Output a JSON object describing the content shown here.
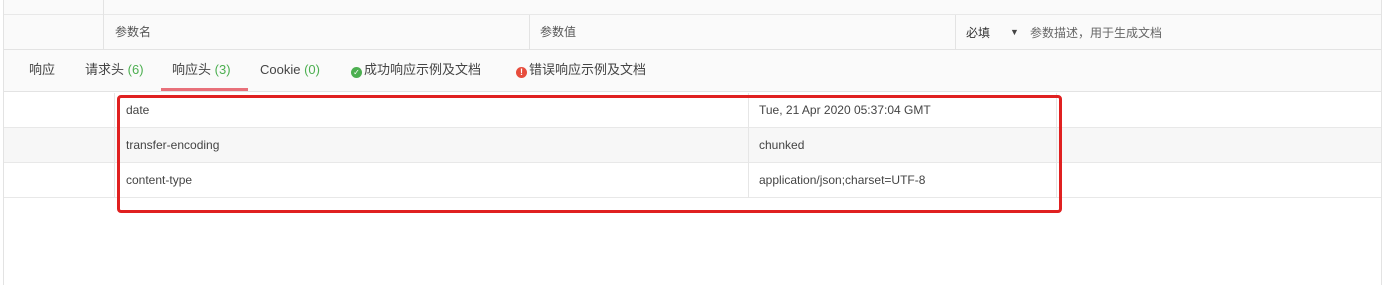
{
  "params_header": {
    "name_placeholder": "参数名",
    "value_placeholder": "参数值",
    "required_label": "必填",
    "description_placeholder": "参数描述，用于生成文档"
  },
  "tabs": [
    {
      "label": "响应",
      "count": ""
    },
    {
      "label": "请求头",
      "count": "(6)"
    },
    {
      "label": "响应头",
      "count": "(3)"
    },
    {
      "label": "Cookie",
      "count": "(0)"
    },
    {
      "label": "成功响应示例及文档",
      "count": ""
    },
    {
      "label": "错误响应示例及文档",
      "count": ""
    }
  ],
  "active_tab": "响应头",
  "icons": {
    "success": "check-circle-icon",
    "error": "exclamation-circle-icon",
    "dropdown": "caret-down-icon"
  },
  "response_headers": [
    {
      "key": "date",
      "value": "Tue, 21 Apr 2020 05:37:04 GMT"
    },
    {
      "key": "transfer-encoding",
      "value": "chunked"
    },
    {
      "key": "content-type",
      "value": "application/json;charset=UTF-8"
    }
  ],
  "colors": {
    "highlight_border": "#e02020",
    "count_green": "#4caf50",
    "active_underline": "#e8707a",
    "error_red": "#e74c3c"
  }
}
